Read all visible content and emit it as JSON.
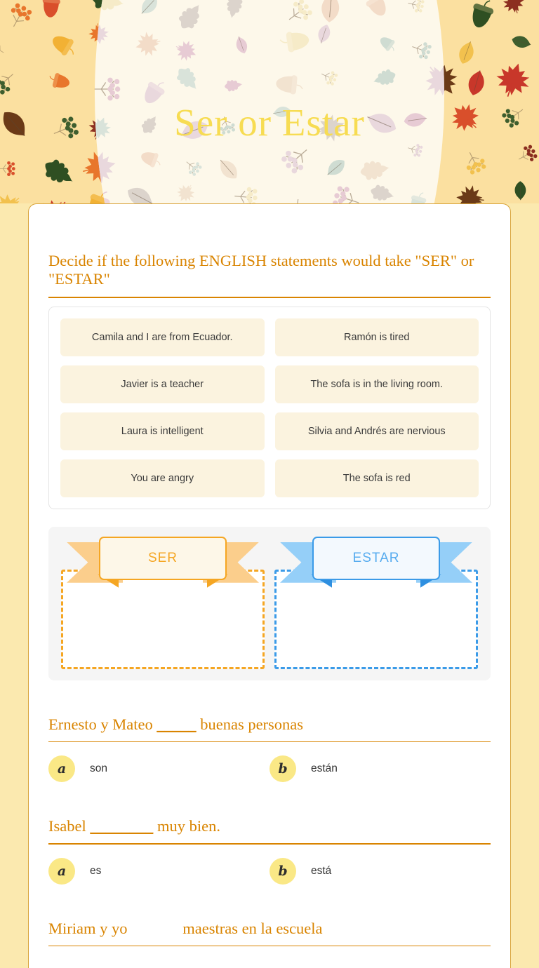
{
  "header": {
    "title": "Ser or Estar",
    "background_color": "#FBE0A0",
    "arch_color": "#FDF8EA",
    "title_color": "#F7DC52"
  },
  "worksheet": {
    "accent_color": "#D98400",
    "instruction": "Decide if the following ENGLISH statements would take \"SER\" or \"ESTAR\"",
    "statements": [
      "Camila and I are from Ecuador.",
      "Ramón is tired",
      "Javier is a teacher",
      "The sofa is in the living room.",
      "Laura is intelligent",
      "Silvia and Andrés are nervious",
      "You are angry",
      "The sofa is red"
    ],
    "categories": [
      {
        "label": "SER",
        "color": "#F5A623"
      },
      {
        "label": "ESTAR",
        "color": "#3B9BE8"
      }
    ],
    "questions": [
      {
        "prefix": "Ernesto y Mateo ",
        "blank": "_____",
        "suffix": " buenas personas",
        "choices": [
          {
            "letter": "a",
            "text": "son"
          },
          {
            "letter": "b",
            "text": "están"
          }
        ]
      },
      {
        "prefix": "Isabel ",
        "blank": "________",
        "suffix": " muy bien.",
        "choices": [
          {
            "letter": "a",
            "text": "es"
          },
          {
            "letter": "b",
            "text": "está"
          }
        ]
      },
      {
        "prefix": "Miriam y yo ",
        "blank": "            ",
        "suffix": " maestras en la escuela",
        "choices": []
      }
    ]
  }
}
